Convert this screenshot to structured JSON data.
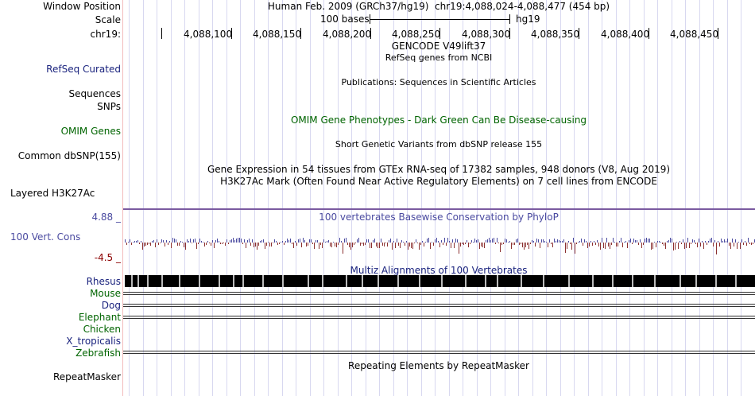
{
  "left_labels": {
    "window_position": "Window Position",
    "scale": "Scale",
    "chrom": "chr19:",
    "refseq": "RefSeq Curated",
    "sequences": "Sequences",
    "snps": "SNPs",
    "omim": "OMIM Genes",
    "common_dbsnp": "Common dbSNP(155)",
    "layered": "Layered H3K27Ac",
    "cons_max": "4.88 _",
    "cons_name": "100 Vert. Cons",
    "cons_min": "-4.5 _",
    "species": [
      "Rhesus",
      "Mouse",
      "Dog",
      "Elephant",
      "Chicken",
      "X_tropicalis",
      "Zebrafish"
    ],
    "repeatmasker": "RepeatMasker"
  },
  "header": {
    "assembly": "Human Feb. 2009 (GRCh37/hg19)",
    "position": "chr19:4,088,024-4,088,477 (454 bp)",
    "scale_bar_label": "100 bases",
    "scale_db": "hg19"
  },
  "ruler": {
    "ticks": [
      "4,088,100",
      "4,088,150",
      "4,088,200",
      "4,088,250",
      "4,088,300",
      "4,088,350",
      "4,088,400",
      "4,088,450"
    ]
  },
  "tracks": {
    "gencode": "GENCODE V49lift37",
    "refseq_desc": "RefSeq genes from NCBI",
    "publications": "Publications: Sequences in Scientific Articles",
    "omim_desc": "OMIM Gene Phenotypes - Dark Green Can Be Disease-causing",
    "dbsnp_desc": "Short Genetic Variants from dbSNP release 155",
    "gtex": "Gene Expression in 54 tissues from GTEx RNA-seq of 17382 samples, 948 donors (V8, Aug 2019)",
    "h3k27ac": "H3K27Ac Mark (Often Found Near Active Regulatory Elements) on 7 cell lines from ENCODE",
    "phylop": "100 vertebrates Basewise Conservation by PhyloP",
    "multiz": "Multiz Alignments of 100 Vertebrates",
    "repeatmasker_desc": "Repeating Elements by RepeatMasker"
  },
  "colors": {
    "label_blue": "#1a237e",
    "label_green": "#006400",
    "phylop_blue": "#4a4aa0",
    "phylop_red": "#8b0000",
    "divider": "#f3bcbc",
    "grid": "#d8d8f0"
  }
}
